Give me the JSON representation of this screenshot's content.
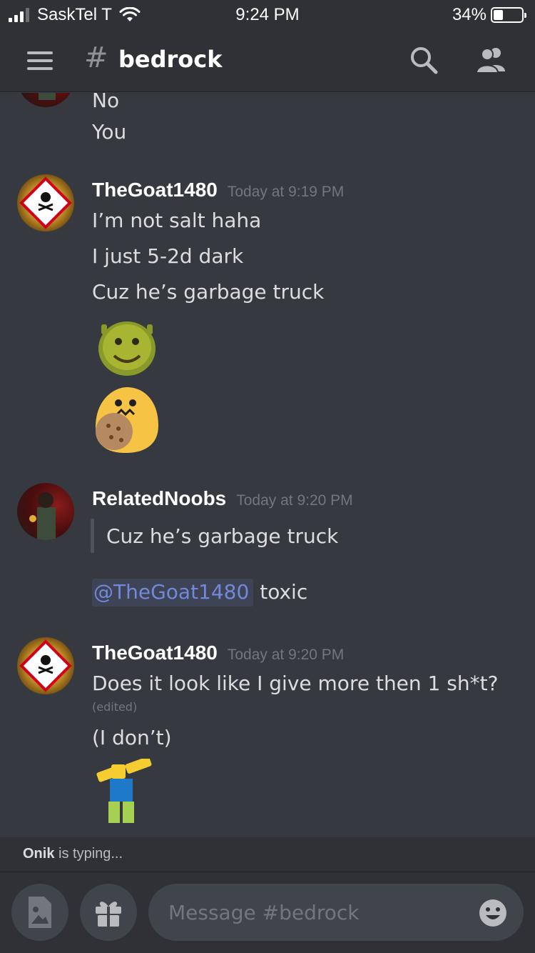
{
  "status_bar": {
    "carrier": "SaskTel T",
    "time": "9:24 PM",
    "battery": "34%",
    "battery_level": 0.34,
    "signal_bars": 3,
    "wifi_icon": "wifi-icon"
  },
  "header": {
    "menu_icon": "hamburger-icon",
    "channel_hash": "#",
    "channel_name": "bedrock",
    "search_icon": "search-icon",
    "members_icon": "members-icon"
  },
  "messages": {
    "partial": {
      "line1": "No",
      "line2": "You"
    },
    "group1": {
      "author": "TheGoat1480",
      "timestamp": "Today at 9:19 PM",
      "lines": [
        "I’m not salt haha",
        "I just 5-2d dark",
        "Cuz he’s garbage truck"
      ],
      "avatar_badge": "TOXIC"
    },
    "group2": {
      "author": "RelatedNoobs",
      "timestamp": "Today at 9:20 PM",
      "quote": "Cuz he’s garbage truck",
      "mention": "@TheGoat1480",
      "after_mention": "toxic"
    },
    "group3": {
      "author": "TheGoat1480",
      "timestamp": "Today at 9:20 PM",
      "line1": "Does it look like I give more then 1 sh*t?",
      "edited": "(edited)",
      "line2": "(I don’t)",
      "avatar_badge": "TOXIC"
    }
  },
  "typing": {
    "user": "Onik",
    "suffix": " is typing..."
  },
  "composer": {
    "placeholder": "Message #bedrock",
    "image_icon": "image-icon",
    "gift_icon": "gift-icon",
    "emoji_icon": "emoji-icon"
  },
  "colors": {
    "background": "#36393f",
    "header": "#2f3136",
    "mention": "#7289da",
    "muted": "#72767d"
  }
}
